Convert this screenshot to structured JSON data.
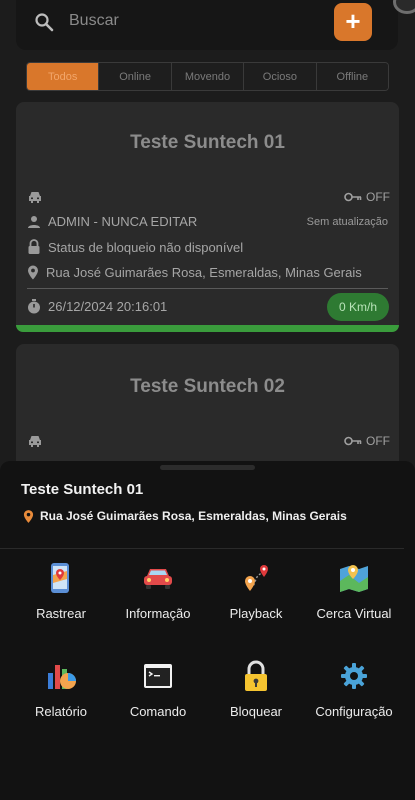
{
  "search": {
    "placeholder": "Buscar",
    "add_label": "+"
  },
  "filters": [
    {
      "label": "Todos",
      "active": true
    },
    {
      "label": "Online",
      "active": false
    },
    {
      "label": "Movendo",
      "active": false
    },
    {
      "label": "Ocioso",
      "active": false
    },
    {
      "label": "Offline",
      "active": false
    }
  ],
  "vehicles": [
    {
      "name": "Teste Suntech 01",
      "ignition": "OFF",
      "user": "ADMIN - NUNCA EDITAR",
      "update_status": "Sem atualização",
      "lock_status": "Status de bloqueio não disponível",
      "address": "Rua José Guimarães Rosa, Esmeraldas, Minas Gerais",
      "datetime": "26/12/2024 20:16:01",
      "speed": "0 Km/h",
      "status_color": "#3a9c3c"
    },
    {
      "name": "Teste Suntech 02",
      "ignition": "OFF"
    }
  ],
  "sheet": {
    "title": "Teste Suntech 01",
    "address": "Rua José Guimarães Rosa, Esmeraldas, Minas Gerais",
    "actions": [
      {
        "label": "Rastrear",
        "icon": "phone-map-icon"
      },
      {
        "label": "Informação",
        "icon": "car-icon"
      },
      {
        "label": "Playback",
        "icon": "route-pins-icon"
      },
      {
        "label": "Cerca Virtual",
        "icon": "map-fence-icon"
      },
      {
        "label": "Relatório",
        "icon": "report-chart-icon"
      },
      {
        "label": "Comando",
        "icon": "terminal-icon"
      },
      {
        "label": "Bloquear",
        "icon": "padlock-icon"
      },
      {
        "label": "Configuração",
        "icon": "gear-icon"
      }
    ]
  },
  "colors": {
    "accent": "#d9772b",
    "online": "#3a9c3c",
    "background": "#1c1c1c",
    "card": "#2a2a2a",
    "sheet": "#121212"
  }
}
